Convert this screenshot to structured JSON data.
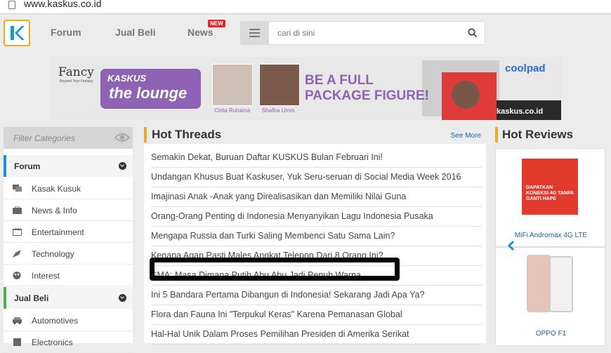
{
  "browser": {
    "url": "www.kaskus.co.id"
  },
  "nav": {
    "logo": "kaskus-logo-icon",
    "forum": "Forum",
    "jual_beli": "Jual Beli",
    "news": "News",
    "news_badge": "NEW",
    "search_placeholder": "cari di sini"
  },
  "banner": {
    "fancy": "Fancy",
    "fancy_sub": "Beyond Your Fantasy",
    "kaskus": "KASKUS",
    "lounge": "the lounge",
    "person1": "Cinta Ruhama",
    "person2": "Shafira Umm",
    "headline1": "BE A FULL",
    "headline2": "PACKAGE FIGURE!",
    "coolpad": "coolpad",
    "site": "kaskus.co.id"
  },
  "sidebar": {
    "filter_placeholder": "Filter Categories",
    "sections": [
      {
        "label": "Forum",
        "items": [
          {
            "label": "Kasak Kusuk",
            "icon": "chat-icon"
          },
          {
            "label": "News & Info",
            "icon": "briefcase-icon"
          },
          {
            "label": "Entertainment",
            "icon": "tv-icon"
          },
          {
            "label": "Technology",
            "icon": "rocket-icon"
          },
          {
            "label": "Interest",
            "icon": "palette-icon"
          }
        ]
      },
      {
        "label": "Jual Beli",
        "items": [
          {
            "label": "Automotives",
            "icon": "car-icon"
          },
          {
            "label": "Electronics",
            "icon": "device-icon"
          }
        ]
      }
    ]
  },
  "hot_threads": {
    "title": "Hot Threads",
    "see_more": "See More",
    "items": [
      "Semakin Dekat, Buruan Daftar KUSKUS Bulan Februari Ini!",
      "Undangan Khusus Buat Kaskuser, Yuk Seru-seruan di Social Media Week 2016",
      "Imajinasi Anak -Anak yang Direalisasikan dan Memiliki Nilai Guna",
      "Orang-Orang Penting di Indonesia Menyanyikan Lagu Indonesia Pusaka",
      "Mengapa Russia dan Turki Saling Membenci Satu Sama Lain?",
      "Kenapa Agan Pasti Males Angkat Telepon Dari 8 Orang Ini?",
      "SMA: Masa Dimana Putih Abu Abu Jadi Penuh Warna",
      "Ini 5 Bandara Pertama Dibangun di Indonesia! Sekarang Jadi Apa Ya?",
      "Flora dan Fauna Ini \"Terpukul Keras\" Karena Pemanasan Global",
      "Hal-Hal Unik Dalam Proses Pemilihan Presiden di Amerika Serikat"
    ]
  },
  "hot_reviews": {
    "title": "Hot Reviews",
    "items": [
      {
        "name": "MiFi Andromax 4G LTE",
        "promo": "DAPATKAN KONEKSI 4G TANPA GANTI HAPE"
      },
      {
        "name": "OPPO F1"
      }
    ]
  },
  "colors": {
    "accent_orange": "#f5a623",
    "forum_blue": "#1a8fdd",
    "jualbeli_green": "#48b14a",
    "link_blue": "#1a5fae"
  }
}
